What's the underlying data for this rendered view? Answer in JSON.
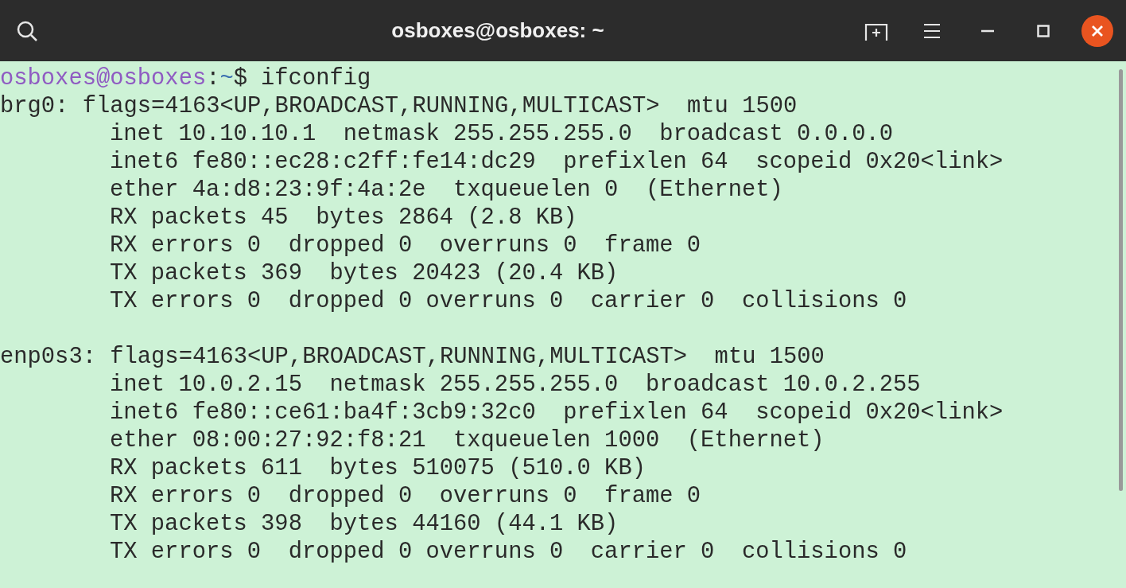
{
  "window": {
    "title": "osboxes@osboxes: ~"
  },
  "prompt": {
    "user_host": "osboxes@osboxes",
    "separator": ":",
    "path": "~",
    "symbol": "$",
    "command": "ifconfig"
  },
  "interfaces": [
    {
      "header": "brg0: flags=4163<UP,BROADCAST,RUNNING,MULTICAST>  mtu 1500",
      "details": [
        "inet 10.10.10.1  netmask 255.255.255.0  broadcast 0.0.0.0",
        "inet6 fe80::ec28:c2ff:fe14:dc29  prefixlen 64  scopeid 0x20<link>",
        "ether 4a:d8:23:9f:4a:2e  txqueuelen 0  (Ethernet)",
        "RX packets 45  bytes 2864 (2.8 KB)",
        "RX errors 0  dropped 0  overruns 0  frame 0",
        "TX packets 369  bytes 20423 (20.4 KB)",
        "TX errors 0  dropped 0 overruns 0  carrier 0  collisions 0"
      ]
    },
    {
      "header": "enp0s3: flags=4163<UP,BROADCAST,RUNNING,MULTICAST>  mtu 1500",
      "details": [
        "inet 10.0.2.15  netmask 255.255.255.0  broadcast 10.0.2.255",
        "inet6 fe80::ce61:ba4f:3cb9:32c0  prefixlen 64  scopeid 0x20<link>",
        "ether 08:00:27:92:f8:21  txqueuelen 1000  (Ethernet)",
        "RX packets 611  bytes 510075 (510.0 KB)",
        "RX errors 0  dropped 0  overruns 0  frame 0",
        "TX packets 398  bytes 44160 (44.1 KB)",
        "TX errors 0  dropped 0 overruns 0  carrier 0  collisions 0"
      ]
    }
  ]
}
